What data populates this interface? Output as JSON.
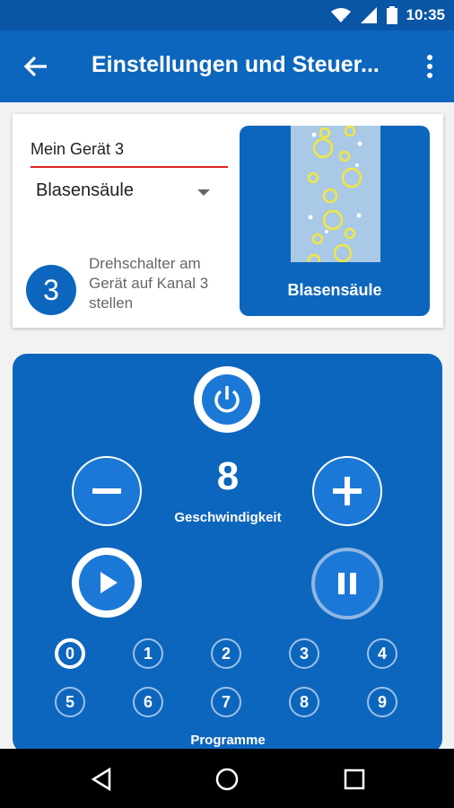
{
  "status": {
    "time": "10:35"
  },
  "appbar": {
    "title": "Einstellungen und Steuer..."
  },
  "device": {
    "name_value": "Mein Gerät 3",
    "type_selected": "Blasensäule",
    "channel_number": "3",
    "channel_hint": "Drehschalter am Gerät auf Kanal 3 stellen",
    "preview_label": "Blasensäule"
  },
  "control": {
    "speed_value": "8",
    "speed_label": "Geschwindigkeit",
    "programs_label": "Programme",
    "programs": [
      "0",
      "1",
      "2",
      "3",
      "4",
      "5",
      "6",
      "7",
      "8",
      "9"
    ],
    "active_program": "0"
  },
  "colors": {
    "primary": "#0d66bd",
    "statusbar": "#0a56a6",
    "accent_underline": "#dd2222",
    "bubble": "#f2e640"
  }
}
